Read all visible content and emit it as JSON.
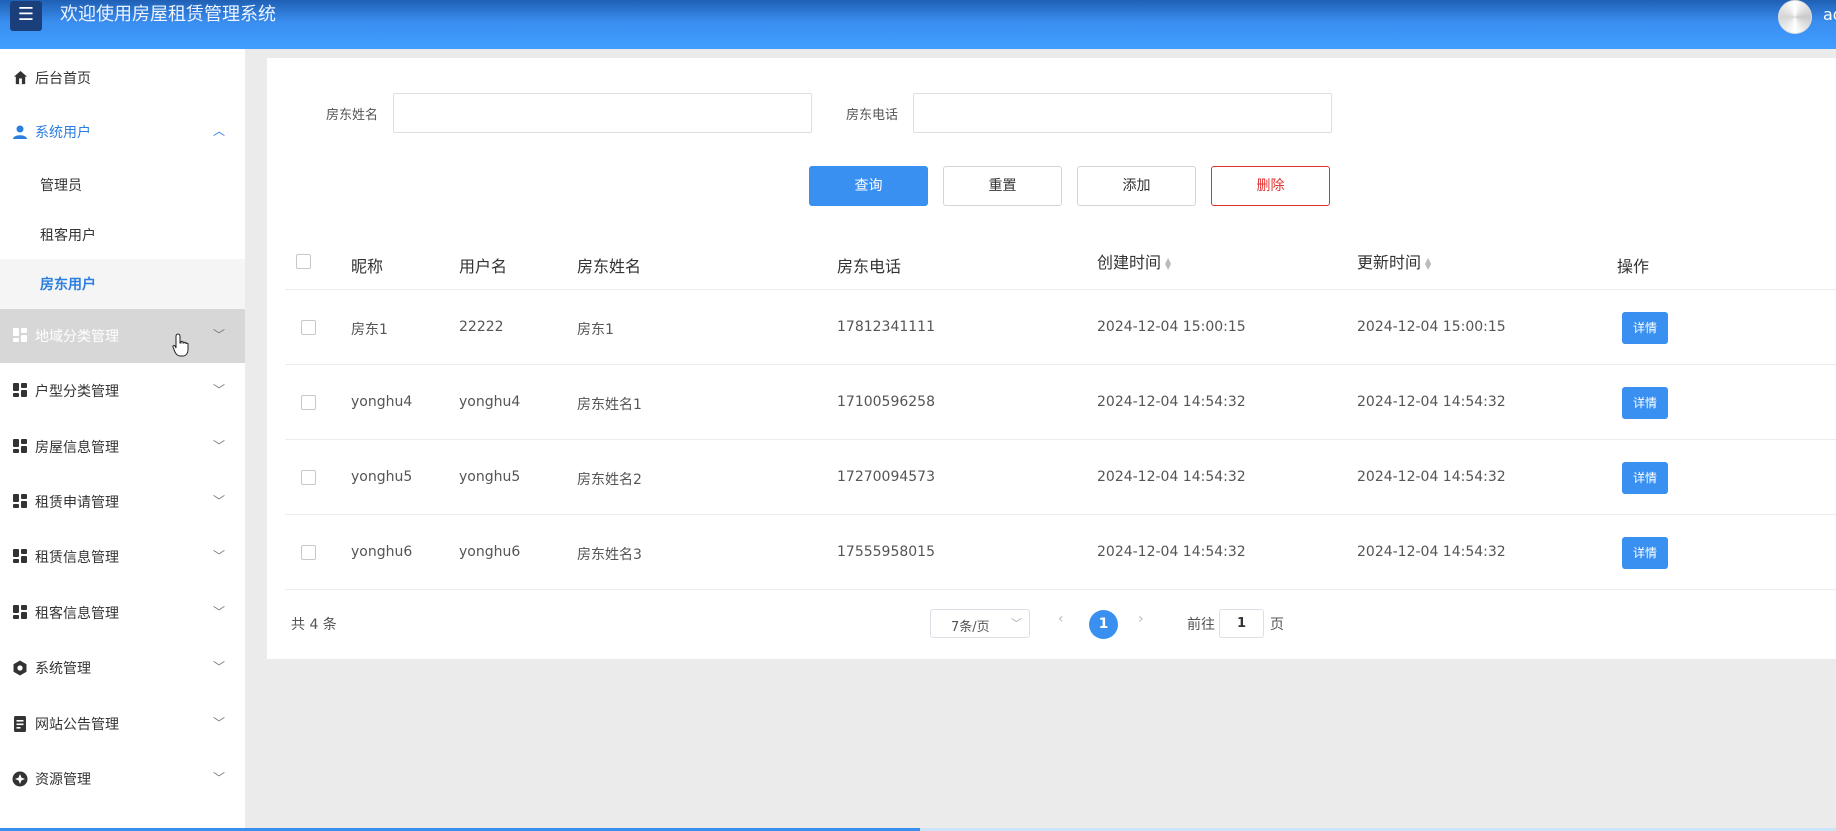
{
  "header": {
    "title": "欢迎使用房屋租赁管理系统",
    "menu_icon": "hamburger-icon",
    "user_name": "ad",
    "colors": {
      "primary": "#409eff",
      "header_dark": "#1f60b4"
    }
  },
  "sidebar": {
    "items": [
      {
        "label": "后台首页",
        "icon": "home-icon"
      },
      {
        "label": "系统用户",
        "icon": "user-icon",
        "expanded": true,
        "children": [
          {
            "label": "管理员"
          },
          {
            "label": "租客用户"
          },
          {
            "label": "房东用户",
            "selected": true
          }
        ]
      },
      {
        "label": "地域分类管理",
        "icon": "grid-icon"
      },
      {
        "label": "户型分类管理",
        "icon": "grid-icon"
      },
      {
        "label": "房屋信息管理",
        "icon": "grid-icon"
      },
      {
        "label": "租赁申请管理",
        "icon": "grid-icon"
      },
      {
        "label": "租赁信息管理",
        "icon": "grid-icon"
      },
      {
        "label": "租客信息管理",
        "icon": "grid-icon"
      },
      {
        "label": "系统管理",
        "icon": "settings-icon"
      },
      {
        "label": "网站公告管理",
        "icon": "document-icon"
      },
      {
        "label": "资源管理",
        "icon": "resource-icon"
      }
    ]
  },
  "search": {
    "landlord_name_label": "房东姓名",
    "landlord_name_value": "",
    "landlord_phone_label": "房东电话",
    "landlord_phone_value": ""
  },
  "toolbar": {
    "query_label": "查询",
    "reset_label": "重置",
    "add_label": "添加",
    "delete_label": "删除"
  },
  "table": {
    "columns": [
      "昵称",
      "用户名",
      "房东姓名",
      "房东电话",
      "创建时间",
      "更新时间",
      "操作"
    ],
    "rows": [
      {
        "nickname": "房东1",
        "username": "22222",
        "name": "房东1",
        "phone": "17812341111",
        "created": "2024-12-04 15:00:15",
        "updated": "2024-12-04 15:00:15",
        "action": "详情"
      },
      {
        "nickname": "yonghu4",
        "username": "yonghu4",
        "name": "房东姓名1",
        "phone": "17100596258",
        "created": "2024-12-04 14:54:32",
        "updated": "2024-12-04 14:54:32",
        "action": "详情"
      },
      {
        "nickname": "yonghu5",
        "username": "yonghu5",
        "name": "房东姓名2",
        "phone": "17270094573",
        "created": "2024-12-04 14:54:32",
        "updated": "2024-12-04 14:54:32",
        "action": "详情"
      },
      {
        "nickname": "yonghu6",
        "username": "yonghu6",
        "name": "房东姓名3",
        "phone": "17555958015",
        "created": "2024-12-04 14:54:32",
        "updated": "2024-12-04 14:54:32",
        "action": "详情"
      }
    ]
  },
  "pagination": {
    "total_text": "共 4 条",
    "page_size": "7条/页",
    "current_page": "1",
    "goto_prefix": "前往",
    "goto_value": "1",
    "goto_suffix": "页"
  }
}
